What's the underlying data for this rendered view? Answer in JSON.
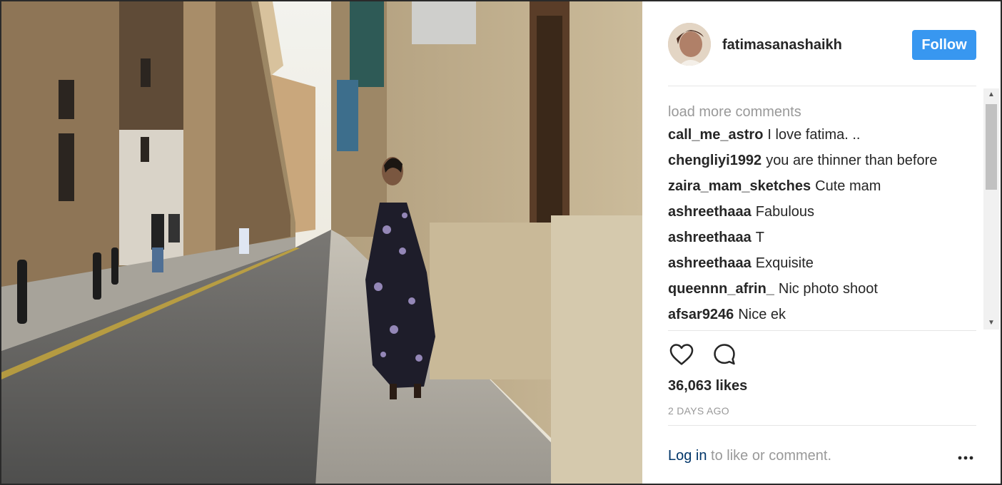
{
  "post": {
    "username": "fatimasanashaikh",
    "follow_label": "Follow"
  },
  "comments_section": {
    "load_more_label": "load more comments",
    "items": [
      {
        "user": "call_me_astro",
        "text": "I love fatima. .."
      },
      {
        "user": "chengliyi1992",
        "text": "you are thinner than before"
      },
      {
        "user": "zaira_mam_sketches",
        "text": "Cute mam"
      },
      {
        "user": "ashreethaaa",
        "text": "Fabulous"
      },
      {
        "user": "ashreethaaa",
        "text": "T"
      },
      {
        "user": "ashreethaaa",
        "text": "Exquisite"
      },
      {
        "user": "queennn_afrin_",
        "text": "Nic photo shoot"
      },
      {
        "user": "afsar9246",
        "text": "Nice ek"
      }
    ]
  },
  "actions": {
    "like_icon": "heart-icon",
    "comment_icon": "comment-bubble-icon"
  },
  "stats": {
    "likes": "36,063 likes",
    "timestamp": "2 DAYS AGO"
  },
  "footer": {
    "login_link": "Log in",
    "login_suffix": " to like or comment.",
    "more_icon": "more-options-icon"
  },
  "colors": {
    "accent": "#3897f0",
    "link": "#003569",
    "muted": "#999999",
    "text": "#262626"
  }
}
